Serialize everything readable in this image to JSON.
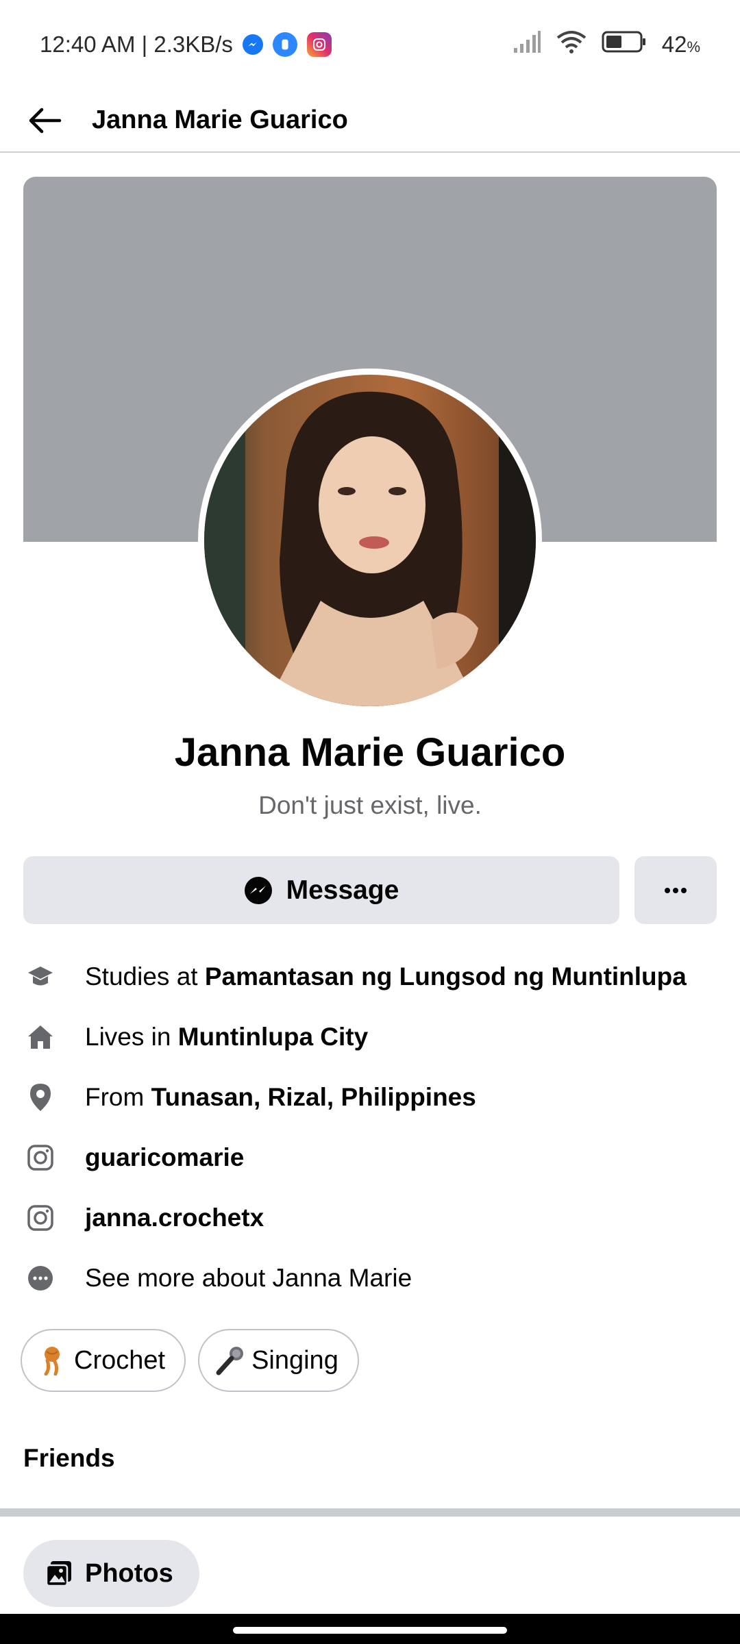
{
  "status_bar": {
    "time_speed": "12:40 AM | 2.3KB/s",
    "battery": "42",
    "battery_unit": "%",
    "icons": [
      "messenger-icon",
      "app-icon",
      "instagram-icon",
      "signal-icon",
      "wifi-icon",
      "battery-icon"
    ]
  },
  "header": {
    "title": "Janna Marie Guarico"
  },
  "profile": {
    "name": "Janna Marie Guarico",
    "bio": "Don't just exist, live."
  },
  "actions": {
    "message_label": "Message",
    "more_label": "···"
  },
  "details": [
    {
      "icon": "graduation-cap-icon",
      "prefix": "Studies at ",
      "bold": "Pamantasan ng Lungsod ng Muntinlupa"
    },
    {
      "icon": "home-icon",
      "prefix": "Lives in ",
      "bold": "Muntinlupa City"
    },
    {
      "icon": "location-pin-icon",
      "prefix": "From ",
      "bold": "Tunasan, Rizal, Philippines"
    },
    {
      "icon": "instagram-icon",
      "prefix": "",
      "bold": "guaricomarie"
    },
    {
      "icon": "instagram-icon",
      "prefix": "",
      "bold": "janna.crochetx"
    },
    {
      "icon": "more-dots-icon",
      "prefix": "See more about Janna Marie",
      "bold": ""
    }
  ],
  "hobbies": [
    {
      "emoji": "yarn-icon",
      "label": "Crochet"
    },
    {
      "emoji": "microphone-icon",
      "label": "Singing"
    }
  ],
  "friends_label": "Friends",
  "photos_label": "Photos",
  "colors": {
    "cover": "#a0a3a8",
    "button_bg": "#e4e6eb",
    "text": "#050505",
    "secondary_text": "#65676b",
    "messenger_blue": "#1877f2"
  }
}
